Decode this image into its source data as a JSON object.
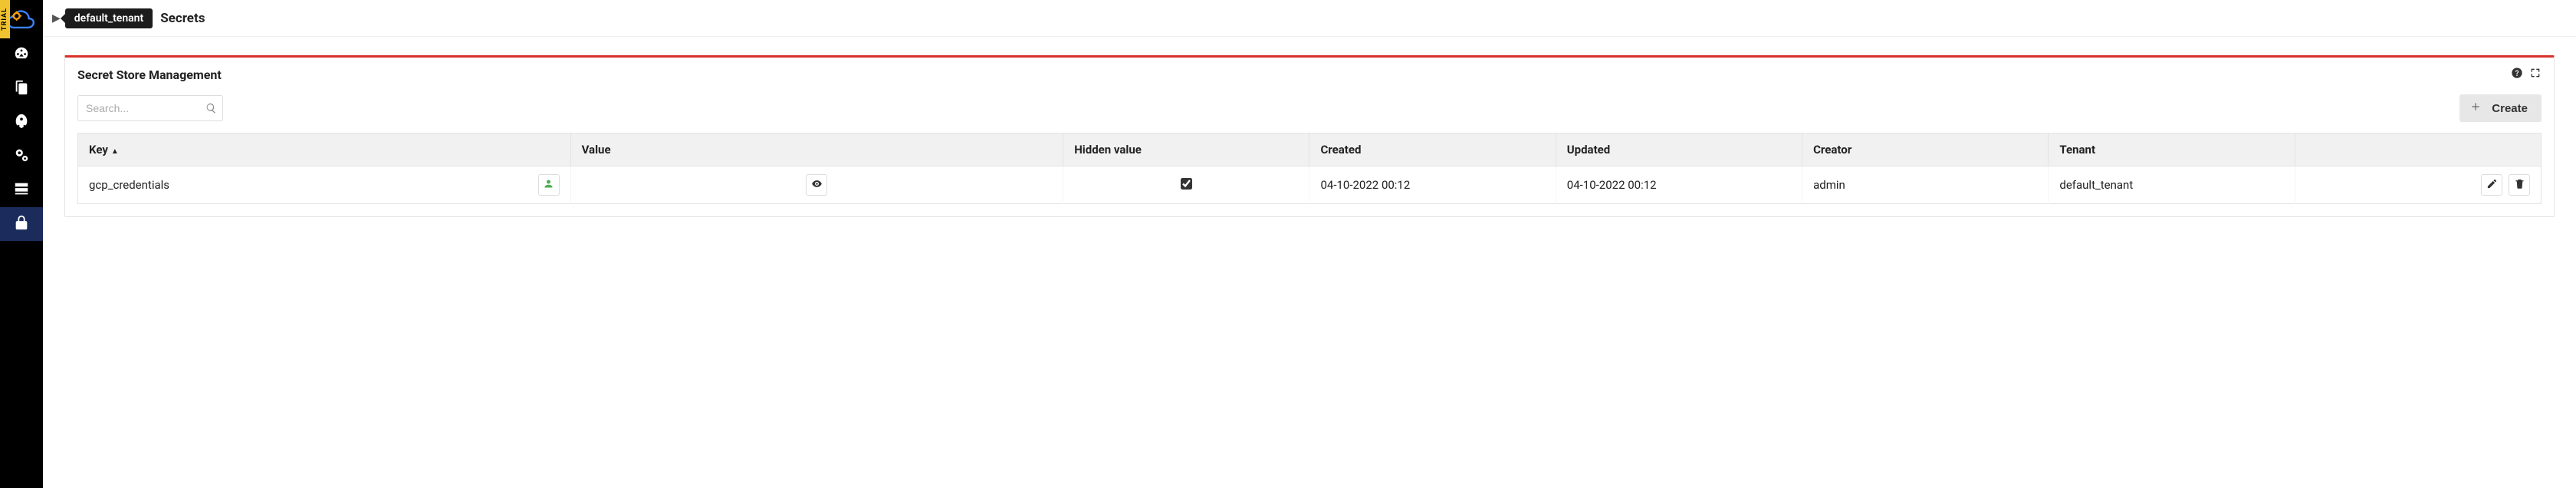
{
  "trial_label": "TRIAL",
  "breadcrumb": {
    "tenant": "default_tenant",
    "page": "Secrets"
  },
  "sidebar": {
    "items": [
      {
        "name": "dashboard"
      },
      {
        "name": "files"
      },
      {
        "name": "deploy"
      },
      {
        "name": "settings"
      },
      {
        "name": "servers"
      },
      {
        "name": "secrets"
      }
    ]
  },
  "panel": {
    "title": "Secret Store Management",
    "search_placeholder": "Search...",
    "create_label": "Create"
  },
  "table": {
    "columns": {
      "key": "Key",
      "value": "Value",
      "hidden_value": "Hidden value",
      "created": "Created",
      "updated": "Updated",
      "creator": "Creator",
      "tenant": "Tenant"
    },
    "rows": [
      {
        "key": "gcp_credentials",
        "hidden_value": true,
        "created": "04-10-2022 00:12",
        "updated": "04-10-2022 00:12",
        "creator": "admin",
        "tenant": "default_tenant"
      }
    ]
  }
}
